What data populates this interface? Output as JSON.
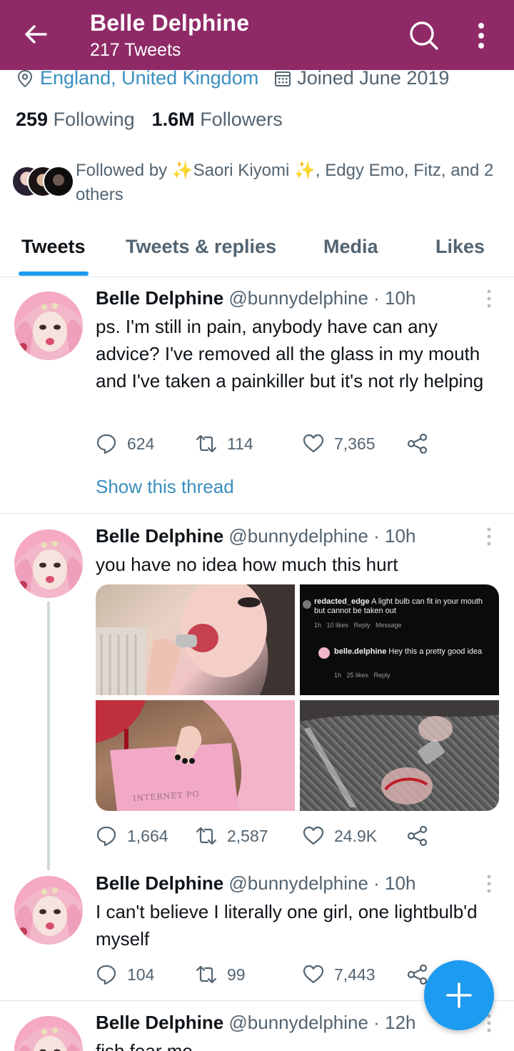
{
  "header": {
    "name": "Belle Delphine",
    "tweet_count": "217 Tweets",
    "icons": [
      "back-arrow-icon",
      "search-icon",
      "more-vertical-icon"
    ],
    "bg_color": "#8f2a67"
  },
  "profile": {
    "location": "England, United Kingdom",
    "joined": "Joined June 2019",
    "following_count": "259",
    "following_label": "Following",
    "followers_count": "1.6M",
    "followers_label": "Followers",
    "followed_by": "Followed by ✨Saori Kiyomi ✨, Edgy Emo, Fitz, and 2 others"
  },
  "tabs": [
    {
      "label": "Tweets",
      "active": true
    },
    {
      "label": "Tweets & replies",
      "active": false
    },
    {
      "label": "Media",
      "active": false
    },
    {
      "label": "Likes",
      "active": false
    }
  ],
  "accent_color": "#1d9bf0",
  "tweets": [
    {
      "name": "Belle Delphine",
      "handle": "@bunnydelphine · 10h",
      "text": "ps. I'm still in pain, anybody have can any advice? I've removed all the glass in my mouth and I've taken a painkiller but it's not rly helping",
      "replies": "624",
      "retweets": "114",
      "likes": "7,365",
      "show_thread": "Show this thread"
    },
    {
      "name": "Belle Delphine",
      "handle": "@bunnydelphine · 10h",
      "text": "you have no idea how much this hurt",
      "replies": "1,664",
      "retweets": "2,587",
      "likes": "24.9K",
      "media": {
        "dm_line1_user": "redacted_edge",
        "dm_line1_text": "A light bulb can fit in your mouth but cannot be taken out",
        "dm_line1_meta": "1h   10 likes   Reply   Message",
        "dm_line2_user": "belle.delphine",
        "dm_line2_text": "Hey this a pretty good idea",
        "dm_line2_meta": "1h   25 likes   Reply",
        "shirt_text": "INTERNET PO"
      }
    },
    {
      "name": "Belle Delphine",
      "handle": "@bunnydelphine · 10h",
      "text": "I can't believe I literally one girl, one lightbulb'd myself",
      "replies": "104",
      "retweets": "99",
      "likes": "7,443"
    },
    {
      "name": "Belle Delphine",
      "handle": "@bunnydelphine · 12h",
      "text": "fish fear me"
    }
  ],
  "fab": {
    "icon": "plus-icon"
  }
}
